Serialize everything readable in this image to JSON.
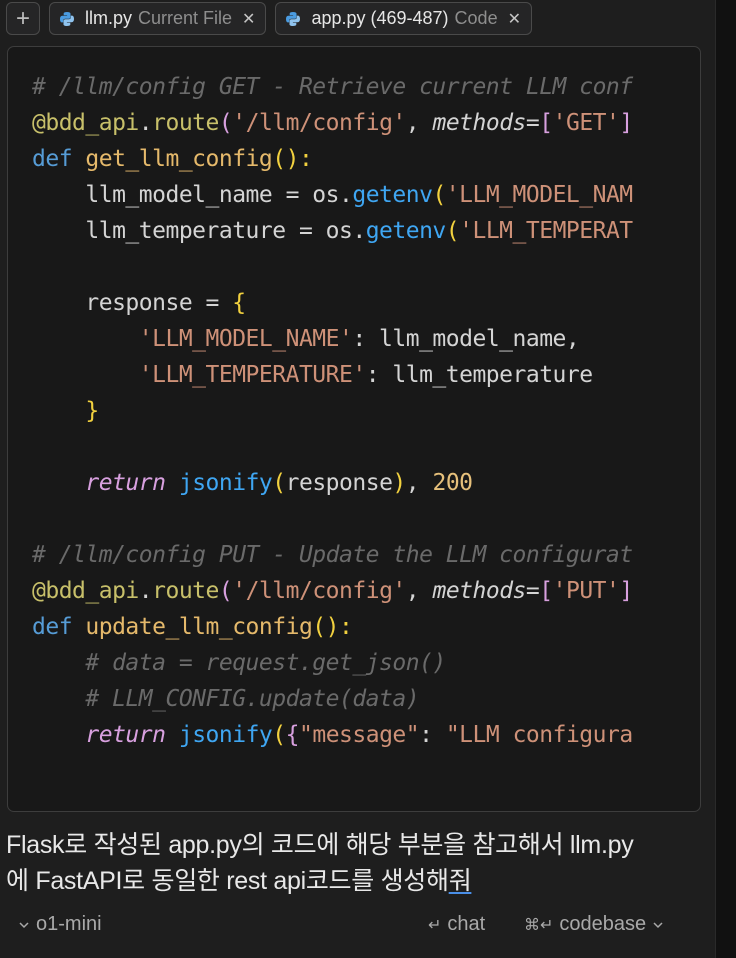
{
  "context_chips": [
    {
      "name": "llm.py",
      "tag": "Current File",
      "icon": "python-icon",
      "close_icon": "close-icon"
    },
    {
      "name": "app.py (469-487)",
      "tag": "Code",
      "icon": "python-icon",
      "close_icon": "close-icon"
    }
  ],
  "add_context_icon": "plus-icon",
  "code_lines": [
    [
      {
        "t": "# /llm/config GET - Retrieve current LLM conf",
        "c": "cm"
      }
    ],
    [
      {
        "t": "@bdd_api",
        "c": "dec"
      },
      {
        "t": ".",
        "c": ""
      },
      {
        "t": "route",
        "c": "dec"
      },
      {
        "t": "(",
        "c": "par"
      },
      {
        "t": "'/llm/config'",
        "c": "str"
      },
      {
        "t": ", ",
        "c": ""
      },
      {
        "t": "methods",
        "c": "it"
      },
      {
        "t": "=",
        "c": ""
      },
      {
        "t": "[",
        "c": "par"
      },
      {
        "t": "'GET'",
        "c": "str"
      },
      {
        "t": "]",
        "c": "par"
      }
    ],
    [
      {
        "t": "def ",
        "c": "kw"
      },
      {
        "t": "get_llm_config",
        "c": "fn"
      },
      {
        "t": "():",
        "c": "br"
      }
    ],
    [
      {
        "t": "    llm_model_name = os.",
        "c": ""
      },
      {
        "t": "getenv",
        "c": "call"
      },
      {
        "t": "(",
        "c": "br"
      },
      {
        "t": "'LLM_MODEL_NAM",
        "c": "str"
      }
    ],
    [
      {
        "t": "    llm_temperature = os.",
        "c": ""
      },
      {
        "t": "getenv",
        "c": "call"
      },
      {
        "t": "(",
        "c": "br"
      },
      {
        "t": "'LLM_TEMPERAT",
        "c": "str"
      }
    ],
    [
      {
        "t": "",
        "c": ""
      }
    ],
    [
      {
        "t": "    response = ",
        "c": ""
      },
      {
        "t": "{",
        "c": "br"
      }
    ],
    [
      {
        "t": "        ",
        "c": ""
      },
      {
        "t": "'LLM_MODEL_NAME'",
        "c": "str"
      },
      {
        "t": ": llm_model_name,",
        "c": ""
      }
    ],
    [
      {
        "t": "        ",
        "c": ""
      },
      {
        "t": "'LLM_TEMPERATURE'",
        "c": "str"
      },
      {
        "t": ": llm_temperature",
        "c": ""
      }
    ],
    [
      {
        "t": "    ",
        "c": ""
      },
      {
        "t": "}",
        "c": "br"
      }
    ],
    [
      {
        "t": "",
        "c": ""
      }
    ],
    [
      {
        "t": "    ",
        "c": ""
      },
      {
        "t": "return",
        "c": "kwi"
      },
      {
        "t": " ",
        "c": ""
      },
      {
        "t": "jsonify",
        "c": "call"
      },
      {
        "t": "(",
        "c": "br"
      },
      {
        "t": "response",
        "c": ""
      },
      {
        "t": ")",
        "c": "br"
      },
      {
        "t": ", ",
        "c": ""
      },
      {
        "t": "200",
        "c": "num"
      }
    ],
    [
      {
        "t": "",
        "c": ""
      }
    ],
    [
      {
        "t": "# /llm/config PUT - Update the LLM configurat",
        "c": "cm"
      }
    ],
    [
      {
        "t": "@bdd_api",
        "c": "dec"
      },
      {
        "t": ".",
        "c": ""
      },
      {
        "t": "route",
        "c": "dec"
      },
      {
        "t": "(",
        "c": "par"
      },
      {
        "t": "'/llm/config'",
        "c": "str"
      },
      {
        "t": ", ",
        "c": ""
      },
      {
        "t": "methods",
        "c": "it"
      },
      {
        "t": "=",
        "c": ""
      },
      {
        "t": "[",
        "c": "par"
      },
      {
        "t": "'PUT'",
        "c": "str"
      },
      {
        "t": "]",
        "c": "par"
      }
    ],
    [
      {
        "t": "def ",
        "c": "kw"
      },
      {
        "t": "update_llm_config",
        "c": "fn"
      },
      {
        "t": "():",
        "c": "br"
      }
    ],
    [
      {
        "t": "    # data = request.get_json()",
        "c": "cm"
      }
    ],
    [
      {
        "t": "    # LLM_CONFIG.update(data)",
        "c": "cm"
      }
    ],
    [
      {
        "t": "    ",
        "c": ""
      },
      {
        "t": "return",
        "c": "kwi"
      },
      {
        "t": " ",
        "c": ""
      },
      {
        "t": "jsonify",
        "c": "call"
      },
      {
        "t": "(",
        "c": "br"
      },
      {
        "t": "{",
        "c": "par"
      },
      {
        "t": "\"message\"",
        "c": "str"
      },
      {
        "t": ": ",
        "c": ""
      },
      {
        "t": "\"LLM configura",
        "c": "str"
      }
    ]
  ],
  "prompt": {
    "line1": "Flask로 작성된 app.py의 코드에 해당 부분을 참고해서 llm.py",
    "line2_start": "에 FastAPI로 동일한 rest api코드를 생성해",
    "line2_end": "줘"
  },
  "bottom_bar": {
    "model_label": "o1-mini",
    "model_icon": "chevron-down-icon",
    "chat_label": "chat",
    "chat_icon": "enter-icon",
    "codebase_label": "codebase",
    "codebase_icon": "cmd-enter-icon",
    "codebase_chevron": "chevron-down-icon"
  }
}
